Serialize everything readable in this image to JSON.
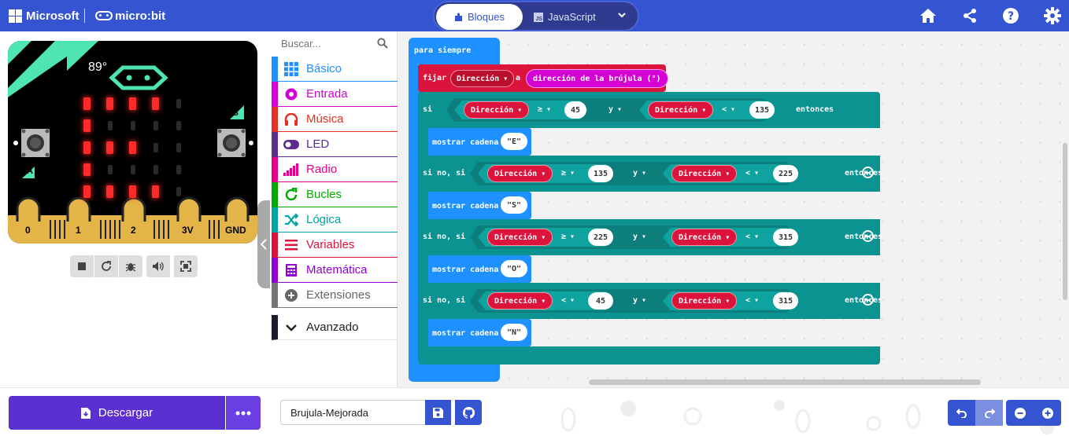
{
  "header": {
    "brand": "Microsoft",
    "product": "micro:bit",
    "tabs": [
      {
        "label": "Bloques",
        "active": true
      },
      {
        "label": "JavaScript",
        "active": false
      }
    ],
    "icons": [
      "home-icon",
      "share-icon",
      "help-icon",
      "settings-icon"
    ]
  },
  "simulator": {
    "heading": "89°",
    "buttons": [
      "A",
      "B"
    ],
    "pins": [
      "0",
      "1",
      "2",
      "3V",
      "GND"
    ],
    "led_matrix": [
      [
        1,
        1,
        1,
        1,
        0
      ],
      [
        1,
        0,
        0,
        0,
        0
      ],
      [
        1,
        1,
        1,
        0,
        0
      ],
      [
        1,
        0,
        0,
        0,
        0
      ],
      [
        1,
        1,
        1,
        1,
        0
      ]
    ],
    "toolbar_icons": [
      "stop-icon",
      "restart-icon",
      "debug-icon",
      "sound-icon",
      "fullscreen-icon"
    ]
  },
  "toolbox": {
    "search_placeholder": "Buscar...",
    "categories": [
      {
        "label": "Básico",
        "color": "#1e90ff"
      },
      {
        "label": "Entrada",
        "color": "#d400d4"
      },
      {
        "label": "Música",
        "color": "#e63022"
      },
      {
        "label": "LED",
        "color": "#5c2d91"
      },
      {
        "label": "Radio",
        "color": "#e3008c"
      },
      {
        "label": "Bucles",
        "color": "#00aa00"
      },
      {
        "label": "Lógica",
        "color": "#00a4a6"
      },
      {
        "label": "Variables",
        "color": "#dc143c"
      },
      {
        "label": "Matemática",
        "color": "#9400d3"
      },
      {
        "label": "Extensiones",
        "color": "#777777"
      }
    ],
    "advanced": "Avanzado"
  },
  "program": {
    "forever": "para siempre",
    "set_label": "fijar",
    "to_label": "a",
    "variable": "Dirección",
    "compass": "dirección de la brújula (°)",
    "if_label": "si",
    "else_if_label": "si no, si",
    "and_label": "y",
    "then_label": "entonces",
    "show_label": "mostrar cadena",
    "branches": [
      {
        "keyword": "si",
        "op1": "≥",
        "v1": "45",
        "op2": "<",
        "v2": "135",
        "output": "\"E\""
      },
      {
        "keyword": "si no, si",
        "op1": "≥",
        "v1": "135",
        "op2": "<",
        "v2": "225",
        "output": "\"S\""
      },
      {
        "keyword": "si no, si",
        "op1": "≥",
        "v1": "225",
        "op2": "<",
        "v2": "315",
        "output": "\"O\""
      },
      {
        "keyword": "si no, si",
        "op1": "<",
        "v1": "45",
        "op2": "<",
        "v2": "315",
        "output": "\"N\""
      }
    ]
  },
  "footer": {
    "download": "Descargar",
    "project_name": "Brujula-Mejorada"
  },
  "colors": {
    "header": "#3454d1",
    "forever": "#1e90ff",
    "logic": "#0a9391",
    "variable": "#dc143c",
    "input": "#d400d4"
  }
}
